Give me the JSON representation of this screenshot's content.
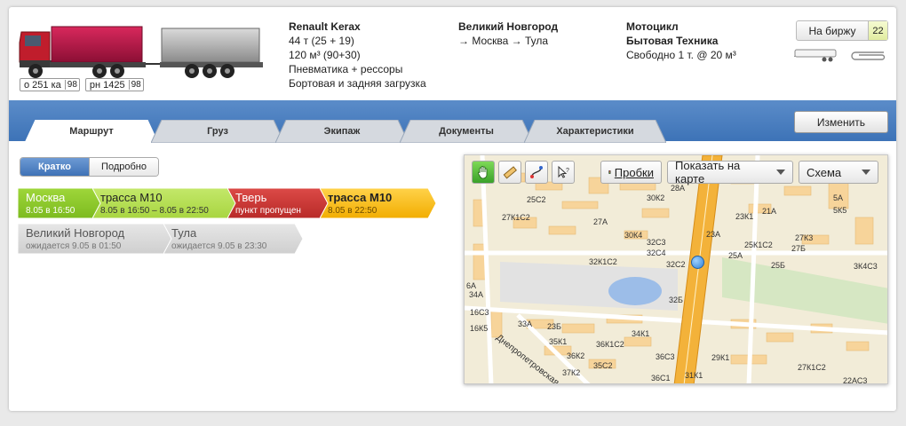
{
  "vehicle": {
    "title": "Renault Kerax",
    "lines": [
      "44 т (25 + 19)",
      "120 м³ (90+30)",
      "Пневматика + рессоры",
      "Бортовая и задняя загрузка"
    ],
    "plate1": {
      "num": "о 251 ка",
      "reg": "98"
    },
    "plate2": {
      "num": "рн 1425",
      "reg": "98"
    }
  },
  "location": {
    "title": "Великий Новгород",
    "route": "→ Москва → Тула"
  },
  "cargo": {
    "title": "Мотоцикл",
    "line1": "Бытовая Техника",
    "line2": "Свободно 1 т. @ 20 м³"
  },
  "exchange": {
    "label": "На биржу",
    "count": "22"
  },
  "tabs": [
    "Маршрут",
    "Груз",
    "Экипаж",
    "Документы",
    "Характеристики"
  ],
  "edit_button": "Изменить",
  "view_switch": {
    "short": "Кратко",
    "detailed": "Подробно"
  },
  "route_points": [
    {
      "name": "Москва",
      "sub": "8.05 в 16:50"
    },
    {
      "name": "трасса М10",
      "sub": "8.05 в 16:50 – 8.05 в 22:50"
    },
    {
      "name": "Тверь",
      "sub": "пункт пропущен"
    },
    {
      "name": "трасса М10",
      "sub": "8.05 в 22:50"
    },
    {
      "name": "Великий Новгород",
      "sub": "ожидается 9.05 в 01:50"
    },
    {
      "name": "Тула",
      "sub": "ожидается 9.05 в 23:30"
    }
  ],
  "map": {
    "traffic_button": "Пробки",
    "show_on_map": "Показать на карте",
    "layer": "Схема",
    "street": "Днепропетровская ул.",
    "labels": [
      "28А",
      "30К2",
      "25С2",
      "27К1С2",
      "27А",
      "30К4",
      "32С3",
      "32К1С2",
      "32С4",
      "32С2",
      "32Б",
      "23А",
      "23К1",
      "25А",
      "25К1С2",
      "27К3",
      "21А",
      "5К5",
      "5А",
      "3К4С3",
      "25Б",
      "27Б",
      "34К1",
      "33А",
      "35К1",
      "36К1С2",
      "36К2",
      "37К2",
      "35С2",
      "36С3",
      "36С1",
      "29К1",
      "31К1",
      "27К1С2",
      "22АС3",
      "34А",
      "16С3",
      "16К5",
      "6А",
      "23Б"
    ]
  },
  "colors": {
    "tab_bar": "#4a7fc1",
    "green": "#8fcf2a",
    "red": "#c8322f",
    "yellow": "#f3b200",
    "grey": "#d4d4d4"
  }
}
